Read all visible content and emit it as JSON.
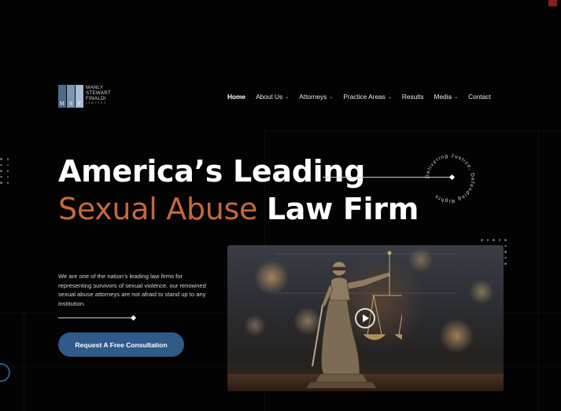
{
  "logo": {
    "letters": [
      "M",
      "S",
      "F"
    ],
    "line1": "MANLY",
    "line2": "STEWART",
    "line3": "FINALDI",
    "line4": "LAWYERS"
  },
  "nav": {
    "items": [
      {
        "label": "Home",
        "active": true,
        "dropdown": false
      },
      {
        "label": "About Us",
        "active": false,
        "dropdown": true
      },
      {
        "label": "Attorneys",
        "active": false,
        "dropdown": true
      },
      {
        "label": "Practice Areas",
        "active": false,
        "dropdown": true
      },
      {
        "label": "Results",
        "active": false,
        "dropdown": false
      },
      {
        "label": "Media",
        "active": false,
        "dropdown": true
      },
      {
        "label": "Contact",
        "active": false,
        "dropdown": false
      }
    ]
  },
  "hero": {
    "title_line1": "America’s Leading",
    "title_accent": "Sexual Abuse",
    "title_bold": "Law Firm",
    "badge_text": "Delivering Justice, Defending Rights",
    "intro": "We are one of the nation’s leading law firms for representing survivors of sexual violence. our renowned sexual abuse attorneys are not afraid to stand up to any institution.",
    "cta_label": "Request A Free Consultation"
  },
  "colors": {
    "background": "#030303",
    "accent": "#c8673b",
    "button": "#2f5a8a"
  },
  "icons": {
    "play": "play-icon",
    "chevron": "chevron-down-icon"
  }
}
